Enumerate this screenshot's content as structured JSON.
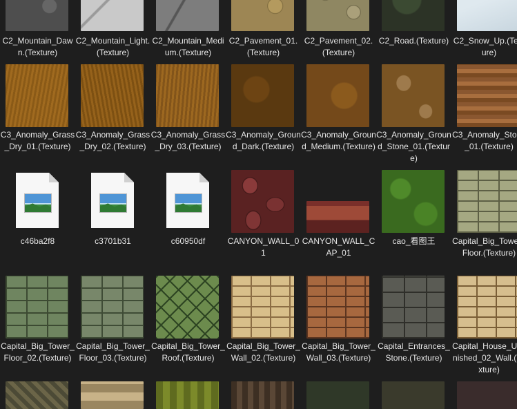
{
  "items": [
    {
      "label": "C2_Mountain_Dawn.(Texture)",
      "texture": "rock-dark"
    },
    {
      "label": "C2_Mountain_Light.(Texture)",
      "texture": "rock-light"
    },
    {
      "label": "C2_Mountain_Medium.(Texture)",
      "texture": "rock-med"
    },
    {
      "label": "C2_Pavement_01.(Texture)",
      "texture": "pave1"
    },
    {
      "label": "C2_Pavement_02.(Texture)",
      "texture": "pave2"
    },
    {
      "label": "C2_Road.(Texture)",
      "texture": "road"
    },
    {
      "label": "C2_Snow_Up.(Texture)",
      "texture": "snow"
    },
    {
      "label": "C3_Anomaly_Grass_Dry_01.(Texture)",
      "texture": "grass1"
    },
    {
      "label": "C3_Anomaly_Grass_Dry_02.(Texture)",
      "texture": "grass2"
    },
    {
      "label": "C3_Anomaly_Grass_Dry_03.(Texture)",
      "texture": "grass3"
    },
    {
      "label": "C3_Anomaly_Ground_Dark.(Texture)",
      "texture": "ground-dark"
    },
    {
      "label": "C3_Anomaly_Ground_Medium.(Texture)",
      "texture": "ground-med"
    },
    {
      "label": "C3_Anomaly_Ground_Stone_01.(Texture)",
      "texture": "ground-stone"
    },
    {
      "label": "C3_Anomaly_Stone_01.(Texture)",
      "texture": "stone01"
    },
    {
      "label": "c46ba2f8",
      "icon": "image-file-icon"
    },
    {
      "label": "c3701b31",
      "icon": "image-file-icon"
    },
    {
      "label": "c60950df",
      "icon": "image-file-icon"
    },
    {
      "label": "CANYON_WALL_01",
      "texture": "canyon-wall"
    },
    {
      "label": "CANYON_WALL_CAP_01",
      "texture": "canyon-cap"
    },
    {
      "label": "cao_看图王",
      "texture": "cao"
    },
    {
      "label": "Capital_Big_Tower_Floor.(Texture)",
      "texture": "brick-olive"
    },
    {
      "label": "Capital_Big_Tower_Floor_02.(Texture)",
      "texture": "brick-green"
    },
    {
      "label": "Capital_Big_Tower_Floor_03.(Texture)",
      "texture": "brick-green2"
    },
    {
      "label": "Capital_Big_Tower_Roof.(Texture)",
      "texture": "roof"
    },
    {
      "label": "Capital_Big_Tower_Wall_02.(Texture)",
      "texture": "brick-tan"
    },
    {
      "label": "Capital_Big_Tower_Wall_03.(Texture)",
      "texture": "brick-red"
    },
    {
      "label": "Capital_Entrances_Stone.(Texture)",
      "texture": "stone-gray"
    },
    {
      "label": "Capital_House_Unfinished_02_Wall.(Texture)",
      "texture": "house"
    },
    {
      "label": "",
      "texture": "b1"
    },
    {
      "label": "",
      "texture": "b2"
    },
    {
      "label": "",
      "texture": "b3"
    },
    {
      "label": "",
      "texture": "b4"
    },
    {
      "label": "",
      "texture": "b5"
    },
    {
      "label": "",
      "texture": "b6"
    },
    {
      "label": "",
      "texture": "b7"
    }
  ]
}
